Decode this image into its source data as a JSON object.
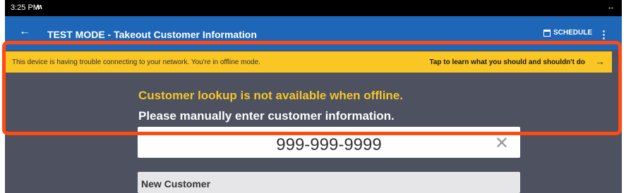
{
  "status_bar": {
    "time": "3:25 PM",
    "app_glyph": "ʍ",
    "right_glyph": "↔"
  },
  "app_bar": {
    "back_icon": "←",
    "title": "TEST MODE - Takeout Customer Information",
    "schedule_label": "SCHEDULE",
    "overflow_icon": "⋮"
  },
  "banner": {
    "message": "This device is having trouble connecting to your network. You're in offline mode.",
    "link": "Tap to learn what you should and shouldn't do",
    "arrow": "→"
  },
  "offline": {
    "title": "Customer lookup is not available when offline.",
    "subtitle": "Please manually enter customer information."
  },
  "phone_field": {
    "value": "999-999-9999",
    "clear_icon": "✕"
  },
  "new_customer": {
    "label": "New Customer"
  },
  "colors": {
    "app_bar": "#1e66b8",
    "banner": "#f9c623",
    "background": "#4d5160",
    "offline_title": "#f4c62b",
    "highlight_border": "#ff4a12"
  }
}
